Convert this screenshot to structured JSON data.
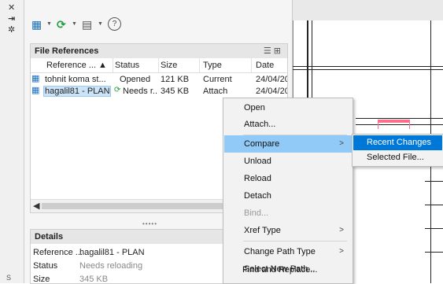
{
  "toolbar": {
    "icons": [
      "attach-dwg-icon",
      "refresh-icon",
      "change-path-icon",
      "help-icon"
    ],
    "help_glyph": "?"
  },
  "file_references": {
    "title": "File References",
    "columns": [
      "Reference ... ▲",
      "Status",
      "Size",
      "Type",
      "Date"
    ],
    "rows": [
      {
        "reference": "tohnit koma st...",
        "status": "Opened",
        "size": "121 KB",
        "type": "Current",
        "date": "24/04/20"
      },
      {
        "reference": "hagalil81 - PLAN",
        "status": "Needs r...",
        "size": "345 KB",
        "type": "Attach",
        "date": "24/04/20"
      }
    ]
  },
  "details": {
    "title": "Details",
    "rows": [
      {
        "label": "Reference ...",
        "value": "hagalil81 - PLAN"
      },
      {
        "label": "Status",
        "value": "Needs reloading"
      },
      {
        "label": "Size",
        "value": "345 KB"
      }
    ]
  },
  "context_menu": {
    "open": "Open",
    "attach": "Attach...",
    "compare": "Compare",
    "unload": "Unload",
    "reload": "Reload",
    "detach": "Detach",
    "bind": "Bind...",
    "xref_type": "Xref Type",
    "change_path_type": "Change Path Type",
    "select_new_path": "Select New Path...",
    "find_and_replace": "Find and Replace..."
  },
  "submenu": {
    "recent_changes": "Recent Changes",
    "selected_file": "Selected File..."
  },
  "colors": {
    "menu_highlight": "#91c9f7",
    "submenu_highlight": "#0078d7",
    "selection": "#cce4f7",
    "reload_icon": "#1c9c3b",
    "drawing_accent": "#ff6f8a"
  }
}
